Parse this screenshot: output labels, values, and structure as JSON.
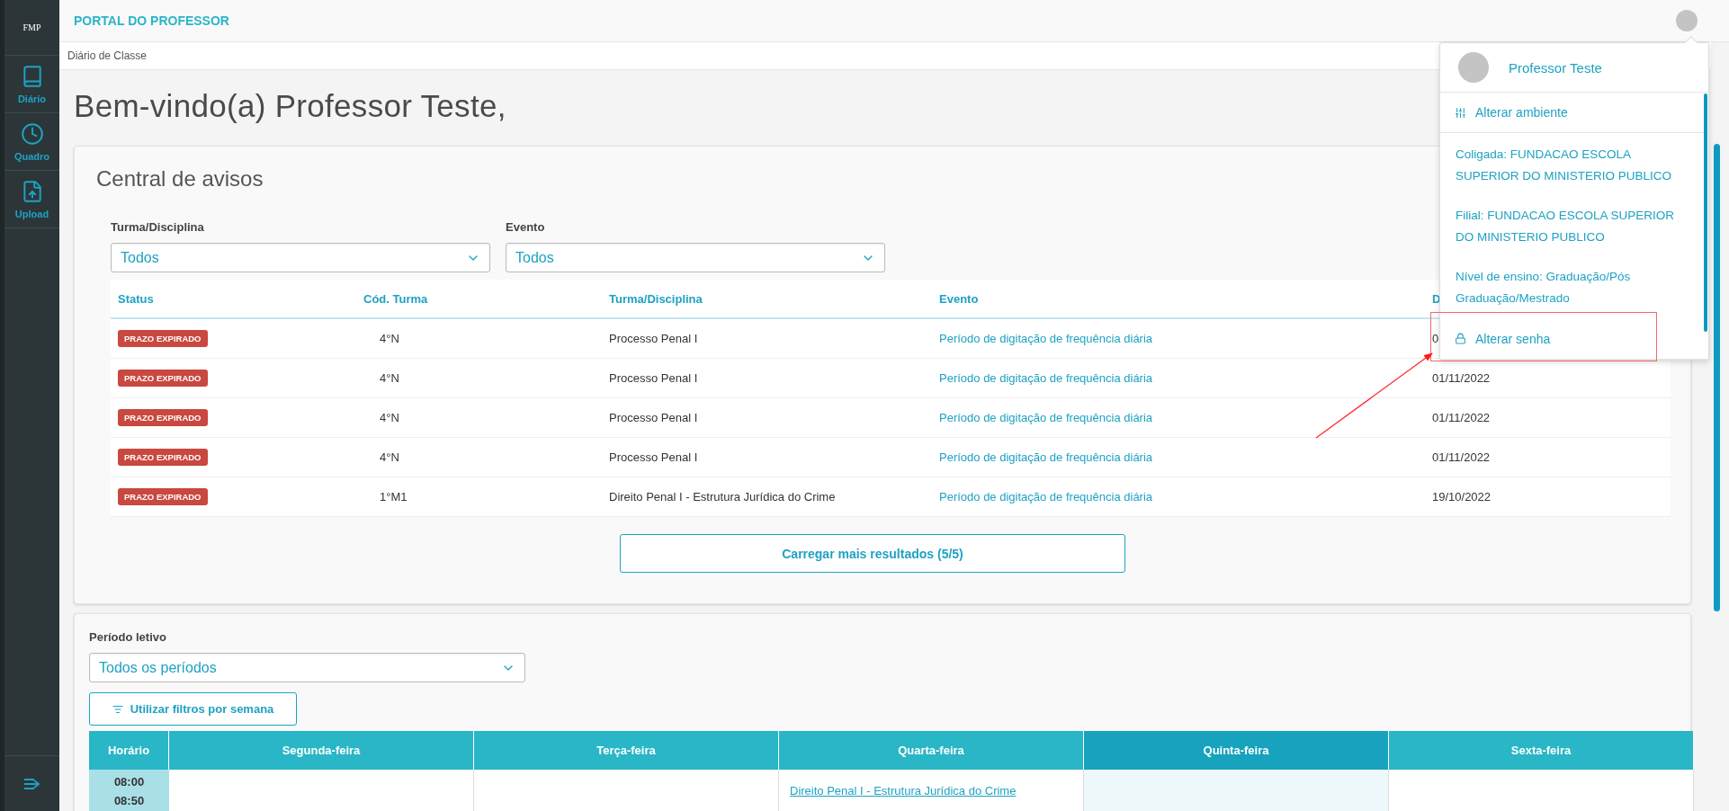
{
  "sidebar": {
    "logo": "FMP",
    "items": [
      {
        "label": "Diário"
      },
      {
        "label": "Quadro"
      },
      {
        "label": "Upload"
      }
    ]
  },
  "header": {
    "title": "PORTAL DO PROFESSOR"
  },
  "breadcrumb": "Diário de Classe",
  "welcome": "Bem-vindo(a) Professor Teste,",
  "notices": {
    "title": "Central de avisos",
    "filters": [
      {
        "label": "Turma/Disciplina",
        "value": "Todos"
      },
      {
        "label": "Evento",
        "value": "Todos"
      }
    ],
    "columns": [
      "Status",
      "Cód. Turma",
      "Turma/Disciplina",
      "Evento",
      "D"
    ],
    "rows": [
      {
        "status": "PRAZO EXPIRADO",
        "code": "4°N",
        "subject": "Processo Penal I",
        "event": "Período de digitação de frequência diária",
        "date": "0"
      },
      {
        "status": "PRAZO EXPIRADO",
        "code": "4°N",
        "subject": "Processo Penal I",
        "event": "Período de digitação de frequência diária",
        "date": "01/11/2022"
      },
      {
        "status": "PRAZO EXPIRADO",
        "code": "4°N",
        "subject": "Processo Penal I",
        "event": "Período de digitação de frequência diária",
        "date": "01/11/2022"
      },
      {
        "status": "PRAZO EXPIRADO",
        "code": "4°N",
        "subject": "Processo Penal I",
        "event": "Período de digitação de frequência diária",
        "date": "01/11/2022"
      },
      {
        "status": "PRAZO EXPIRADO",
        "code": "1°M1",
        "subject": "Direito Penal I - Estrutura Jurídica do Crime",
        "event": "Período de digitação de frequência diária",
        "date": "19/10/2022"
      }
    ],
    "load_more": "Carregar mais resultados (5/5)"
  },
  "schedule": {
    "period_label": "Período letivo",
    "period_value": "Todos os períodos",
    "filter_button": "Utilizar filtros por semana",
    "columns": [
      {
        "label": "Horário",
        "today": false
      },
      {
        "label": "Segunda-feira",
        "today": false
      },
      {
        "label": "Terça-feira",
        "today": false
      },
      {
        "label": "Quarta-feira",
        "today": false
      },
      {
        "label": "Quinta-feira",
        "today": true
      },
      {
        "label": "Sexta-feira",
        "today": false
      }
    ],
    "rows": [
      {
        "cells": [
          {
            "times": [
              "08:00",
              "08:50"
            ]
          },
          {},
          {},
          {
            "link": "Direito Penal I - Estrutura Jurídica do Crime"
          },
          {},
          {}
        ]
      }
    ]
  },
  "user_menu": {
    "name": "Professor Teste",
    "change_environment": "Alterar ambiente",
    "info": [
      "Coligada: FUNDACAO ESCOLA SUPERIOR DO MINISTERIO PUBLICO",
      "Filial: FUNDACAO ESCOLA SUPERIOR DO MINISTERIO PUBLICO",
      "Nível de ensino: Graduação/Pós Graduação/Mestrado"
    ],
    "change_password": "Alterar senha"
  }
}
